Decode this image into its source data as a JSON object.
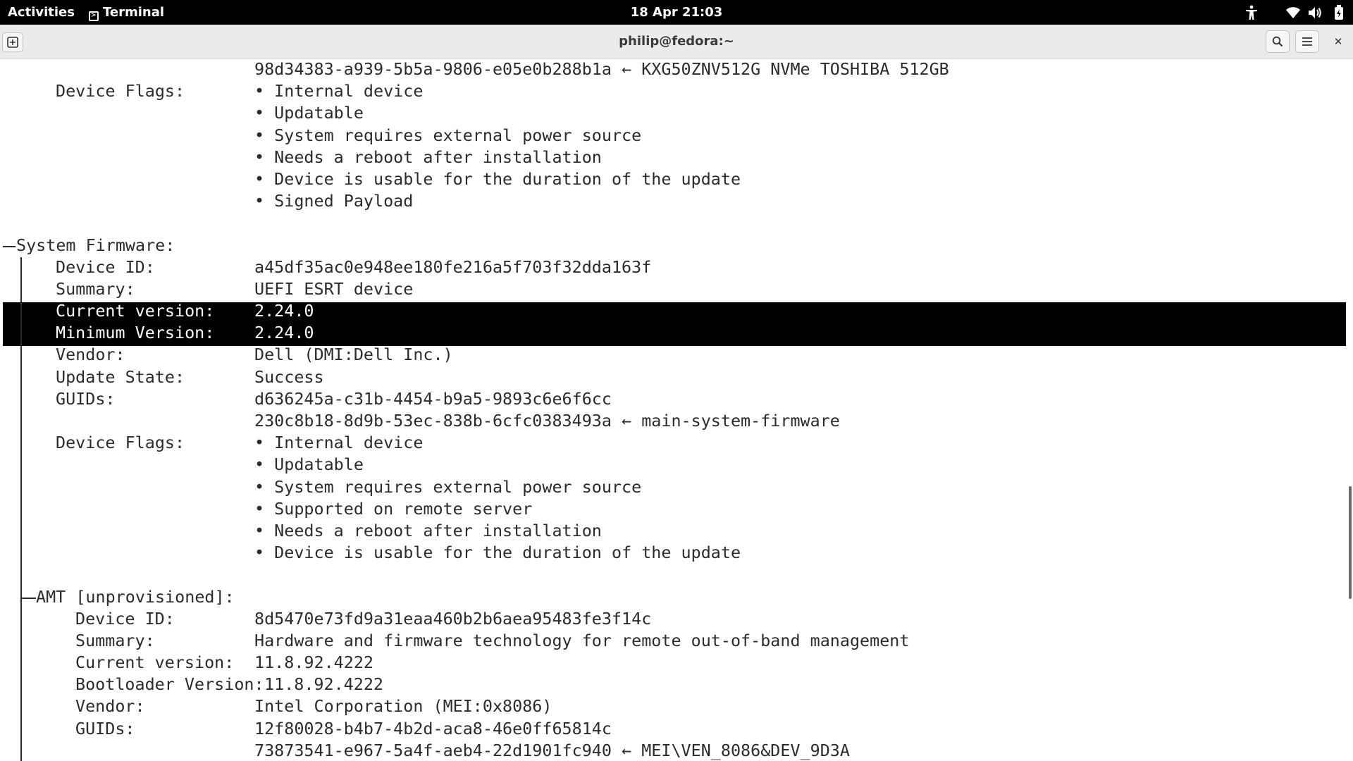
{
  "topbar": {
    "activities": "Activities",
    "app_name": "Terminal",
    "clock": "18 Apr  21:03",
    "icons": [
      "accessibility-icon",
      "wifi-icon",
      "volume-icon",
      "battery-icon"
    ]
  },
  "window": {
    "title": "philip@fedora:~",
    "buttons": [
      "new-tab-icon",
      "search-icon",
      "menu-icon",
      "close-icon"
    ]
  },
  "terminal": {
    "prev_guid": "98d34383-a939-5b5a-9806-e05e0b288b1a ← KXG50ZNV512G NVMe TOSHIBA 512GB",
    "prev_flags_label": "Device Flags:",
    "prev_flags": [
      "• Internal device",
      "• Updatable",
      "• System requires external power source",
      "• Needs a reboot after installation",
      "• Device is usable for the duration of the update",
      "• Signed Payload"
    ],
    "sysfw": {
      "header": "System Firmware:",
      "device_id_label": "Device ID:",
      "device_id": "a45df35ac0e948ee180fe216a5f703f32dda163f",
      "summary_label": "Summary:",
      "summary": "UEFI ESRT device",
      "current_label": "Current version:",
      "current": "2.24.0",
      "minimum_label": "Minimum Version:",
      "minimum": "2.24.0",
      "vendor_label": "Vendor:",
      "vendor": "Dell (DMI:Dell Inc.)",
      "update_state_label": "Update State:",
      "update_state": "Success",
      "guids_label": "GUIDs:",
      "guids": [
        "d636245a-c31b-4454-b9a5-9893c6e6f6cc",
        "230c8b18-8d9b-53ec-838b-6cfc0383493a ← main-system-firmware"
      ],
      "flags_label": "Device Flags:",
      "flags": [
        "• Internal device",
        "• Updatable",
        "• System requires external power source",
        "• Supported on remote server",
        "• Needs a reboot after installation",
        "• Device is usable for the duration of the update"
      ]
    },
    "amt": {
      "header": "AMT [unprovisioned]:",
      "device_id_label": "Device ID:",
      "device_id": "8d5470e73fd9a31eaa460b2b6aea95483fe3f14c",
      "summary_label": "Summary:",
      "summary": "Hardware and firmware technology for remote out-of-band management",
      "current_label": "Current version:",
      "current": "11.8.92.4222",
      "bootloader_label": "Bootloader Version:",
      "bootloader": "11.8.92.4222",
      "vendor_label": "Vendor:",
      "vendor": "Intel Corporation (MEI:0x8086)",
      "guids_label": "GUIDs:",
      "guids": [
        "12f80028-b4b7-4b2d-aca8-46e0ff65814c",
        "73873541-e967-5a4f-aeb4-22d1901fc940 ← MEI\\VEN_8086&DEV_9D3A"
      ]
    }
  }
}
